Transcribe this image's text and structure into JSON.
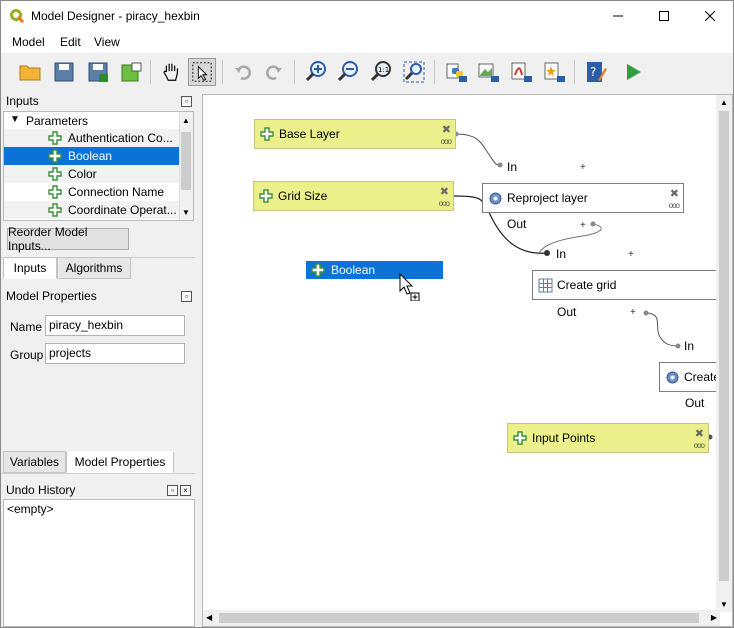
{
  "window": {
    "title": "Model Designer - piracy_hexbin",
    "accent": "#0b73d8"
  },
  "menu": [
    "Model",
    "Edit",
    "View"
  ],
  "inputs_panel": {
    "title": "Inputs",
    "tree_root": "Parameters",
    "items": [
      "Authentication Co...",
      "Boolean",
      "Color",
      "Connection Name",
      "Coordinate Operat..."
    ],
    "selected_index": 1,
    "reorder_button": "Reorder Model Inputs..."
  },
  "left_tabs": [
    "Inputs",
    "Algorithms"
  ],
  "model_properties": {
    "title": "Model Properties",
    "name_label": "Name",
    "name_value": "piracy_hexbin",
    "group_label": "Group",
    "group_value": "projects"
  },
  "bottom_tabs": [
    "Variables",
    "Model Properties"
  ],
  "undo": {
    "title": "Undo History",
    "empty": "<empty>"
  },
  "canvas": {
    "nodes": {
      "base_layer": "Base Layer",
      "grid_size": "Grid Size",
      "reproject": "Reproject layer",
      "create_grid": "Create grid",
      "create_partial": "Create",
      "input_points": "Input Points"
    },
    "ports": {
      "in": "In",
      "out": "Out"
    },
    "dragging": "Boolean"
  }
}
